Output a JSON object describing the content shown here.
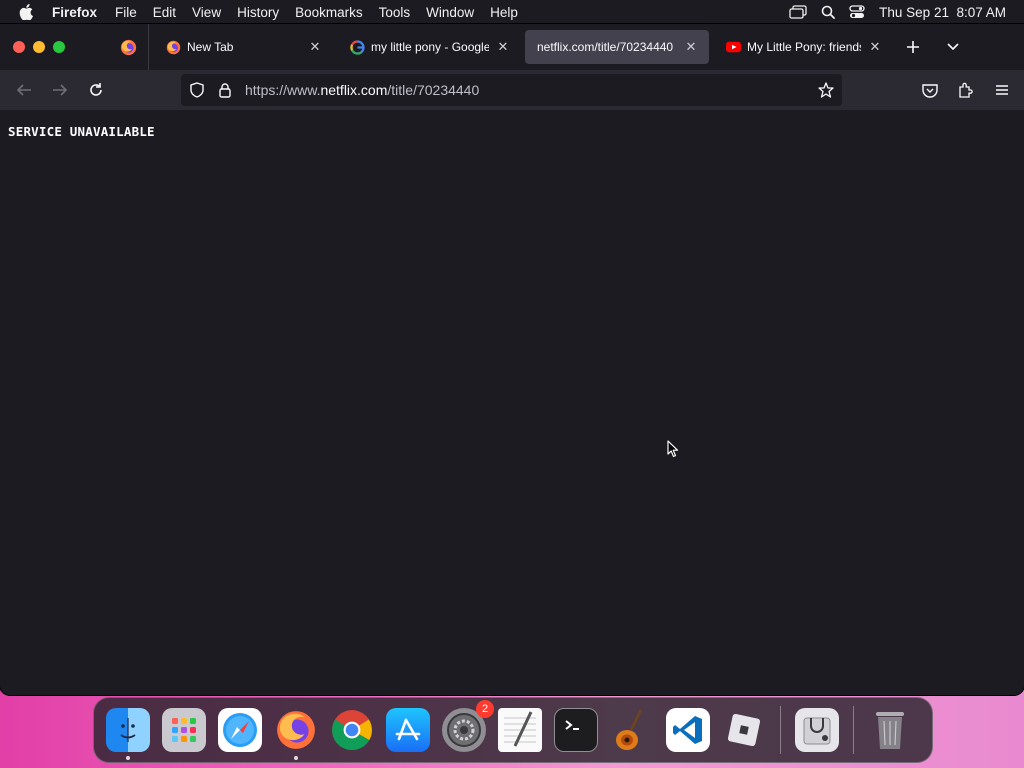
{
  "menubar": {
    "app_name": "Firefox",
    "items": [
      "File",
      "Edit",
      "View",
      "History",
      "Bookmarks",
      "Tools",
      "Window",
      "Help"
    ],
    "clock": "Thu Sep 21  8:07 AM"
  },
  "tabs": [
    {
      "title": "New Tab",
      "favicon": "firefox-icon"
    },
    {
      "title": "my little pony - Google Search",
      "favicon": "google-icon"
    },
    {
      "title": "netflix.com/title/70234440",
      "favicon": "none",
      "active": true
    },
    {
      "title": "My Little Pony: friendship",
      "favicon": "youtube-icon"
    }
  ],
  "urlbar": {
    "prefix": "https://www.",
    "domain": "netflix.com",
    "path": "/title/70234440"
  },
  "content": {
    "message": "SERVICE UNAVAILABLE"
  },
  "dock": {
    "apps": [
      "Finder",
      "Launchpad",
      "Safari",
      "Firefox",
      "Chrome",
      "App Store",
      "System Settings",
      "TextEdit",
      "Terminal",
      "GarageBand",
      "VS Code",
      "Roblox",
      "Disk Utility",
      "Trash"
    ],
    "settings_badge": "2"
  },
  "colors": {
    "chrome_bg": "#1c1b22",
    "toolbar_bg": "#2b2a33",
    "active_tab": "#42414d",
    "desktop": "#f06cc0"
  }
}
